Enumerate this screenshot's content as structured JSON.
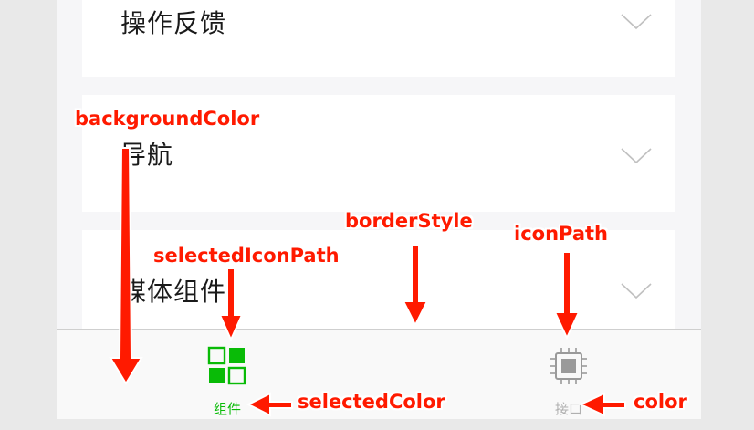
{
  "list": {
    "items": [
      {
        "label": "操作反馈"
      },
      {
        "label": "导航"
      },
      {
        "label": "媒体组件"
      }
    ]
  },
  "tabbar": {
    "background": "#f9f9f9",
    "tabs": [
      {
        "label": "组件",
        "icon": "grid-icon",
        "selected": true,
        "color": "#09bb07"
      },
      {
        "label": "接口",
        "icon": "chip-icon",
        "selected": false,
        "color": "#b0b0b0"
      }
    ]
  },
  "annotations": {
    "background_color": "backgroundColor",
    "border_style": "borderStyle",
    "icon_path": "iconPath",
    "selected_icon_path": "selectedIconPath",
    "selected_color": "selectedColor",
    "color": "color"
  },
  "colors": {
    "annotation": "#ff1a00",
    "selected": "#09bb07",
    "unselected": "#b0b0b0",
    "page_background": "#f6f6f8"
  }
}
